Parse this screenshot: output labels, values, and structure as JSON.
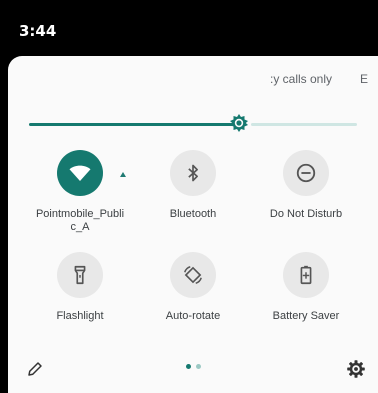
{
  "status": {
    "time": "3:44"
  },
  "header": {
    "carrier_text": ":y calls only",
    "carrier_text_2": "E"
  },
  "brightness": {
    "level_percent": 64
  },
  "tiles": [
    {
      "label": "Pointmobile_Publi\nc_A",
      "icon": "wifi-icon",
      "active": true
    },
    {
      "label": "Bluetooth",
      "icon": "bluetooth-icon",
      "active": false
    },
    {
      "label": "Do Not Disturb",
      "icon": "do-not-disturb-icon",
      "active": false
    },
    {
      "label": "Flashlight",
      "icon": "flashlight-icon",
      "active": false
    },
    {
      "label": "Auto-rotate",
      "icon": "auto-rotate-icon",
      "active": false
    },
    {
      "label": "Battery Saver",
      "icon": "battery-saver-icon",
      "active": false
    }
  ],
  "footer": {
    "page_count": 2,
    "current_page": 1
  },
  "colors": {
    "accent": "#15796f",
    "inactive_tile": "#e8e8e8",
    "dot_active": "#15796f",
    "dot_inactive": "#9cc9c4"
  }
}
